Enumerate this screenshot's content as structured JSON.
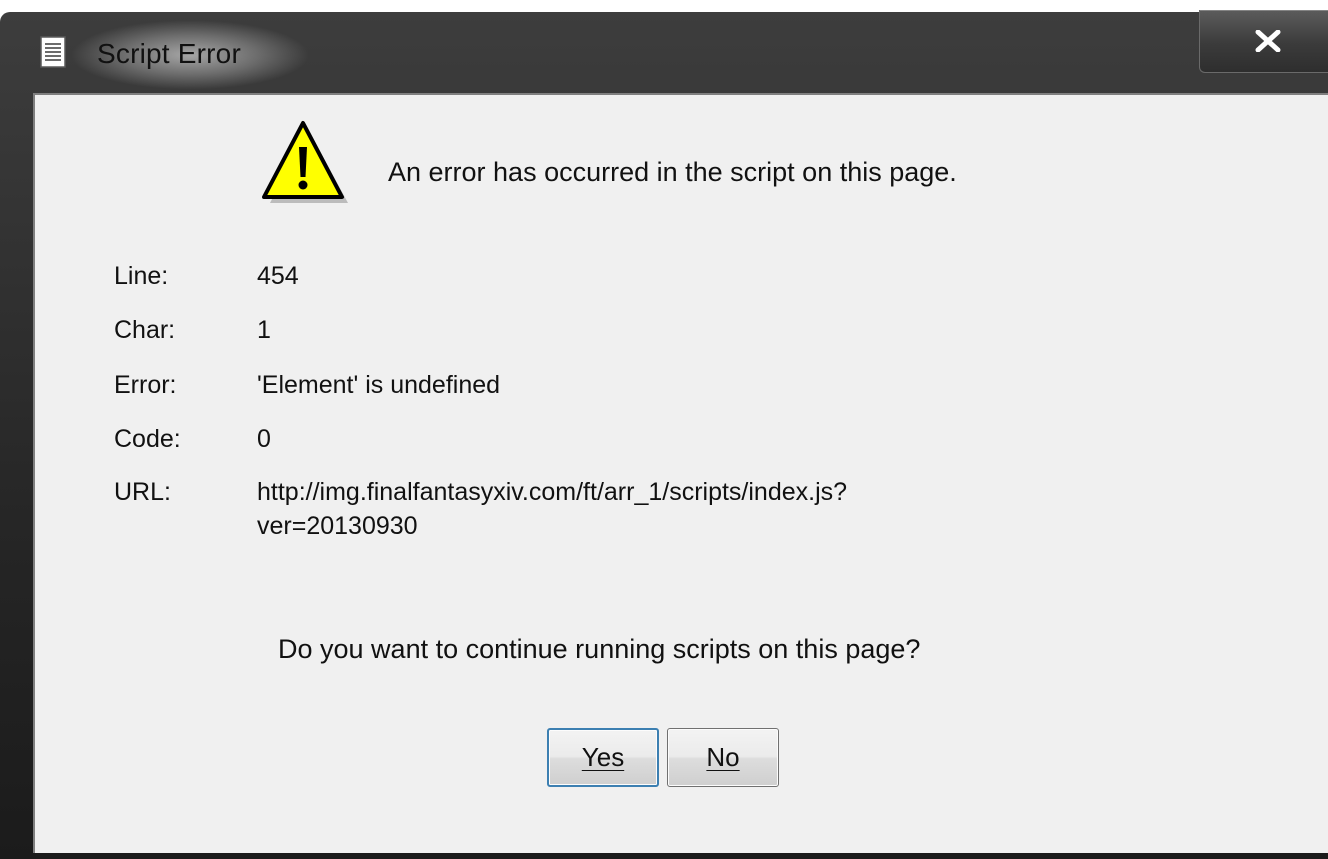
{
  "window": {
    "title": "Script Error",
    "title_icon": "document-icon",
    "close_icon": "close-icon"
  },
  "dialog": {
    "warning_icon": "warning-triangle-icon",
    "headline": "An error has occurred in the script on this page.",
    "details": [
      {
        "label": "Line:",
        "value": "454"
      },
      {
        "label": "Char:",
        "value": "1"
      },
      {
        "label": "Error:",
        "value": "'Element' is undefined"
      },
      {
        "label": "Code:",
        "value": "0"
      },
      {
        "label": "URL:",
        "value": "http://img.finalfantasyxiv.com/ft/arr_1/scripts/index.js?",
        "value_line2": "ver=20130930"
      }
    ],
    "question": "Do you want to continue running scripts on this page?",
    "buttons": {
      "yes": "Yes",
      "no": "No"
    }
  },
  "colors": {
    "frame_dark": "#262626",
    "client_bg": "#f0f0f0",
    "warning_yellow": "#ffff00",
    "focus_border": "#3c7fb1"
  }
}
